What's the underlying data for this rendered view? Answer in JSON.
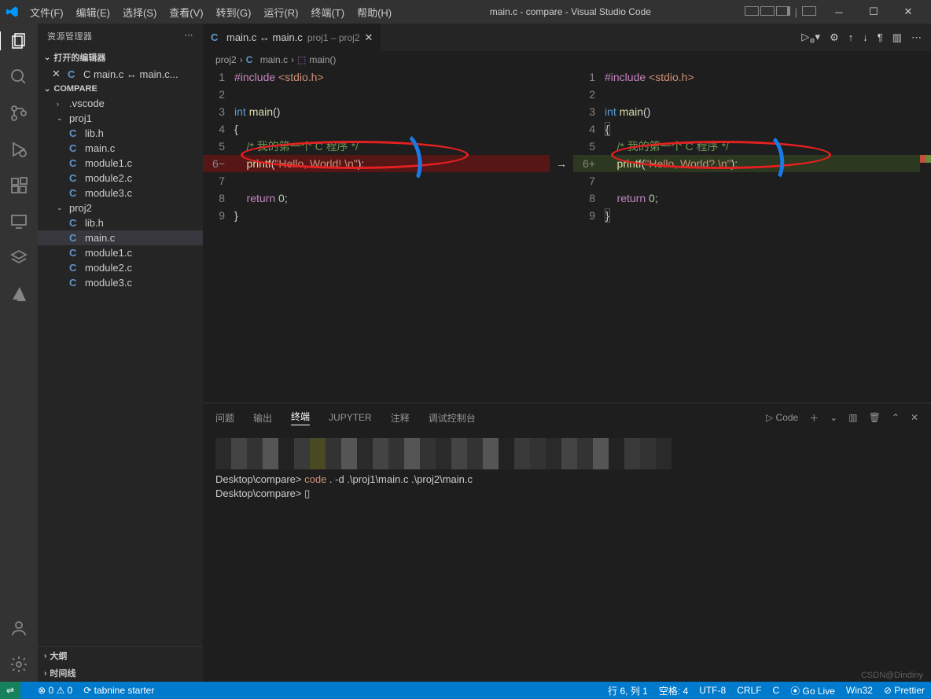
{
  "titlebar": {
    "menu": [
      "文件(F)",
      "编辑(E)",
      "选择(S)",
      "查看(V)",
      "转到(G)",
      "运行(R)",
      "终端(T)",
      "帮助(H)"
    ],
    "title": "main.c - compare - Visual Studio Code"
  },
  "sidebar": {
    "title": "资源管理器",
    "open_editors": "打开的编辑器",
    "open_item": "C  main.c ↔ main.c...",
    "workspace": "COMPARE",
    "tree": {
      "vscode": ".vscode",
      "proj1": "proj1",
      "proj1_files": [
        "lib.h",
        "main.c",
        "module1.c",
        "module2.c",
        "module3.c"
      ],
      "proj2": "proj2",
      "proj2_files": [
        "lib.h",
        "main.c",
        "module1.c",
        "module2.c",
        "module3.c"
      ]
    },
    "outline": "大纲",
    "timeline": "时间线"
  },
  "tab": {
    "icon": "C",
    "name": "main.c ↔ main.c",
    "detail": "proj1 – proj2"
  },
  "breadcrumb": {
    "folder": "proj2",
    "file": "main.c",
    "symbol": "main()"
  },
  "code_left": {
    "lines": [
      "1",
      "2",
      "3",
      "4",
      "5",
      "6−",
      "7",
      "8",
      "9"
    ],
    "l1_a": "#include",
    "l1_b": "<stdio.h>",
    "l3_a": "int",
    "l3_b": "main",
    "l3_c": "()",
    "l4": "{",
    "l5": "    /* 我的第一个 C 程序 */",
    "l6_a": "    printf",
    "l6_b": "(",
    "l6_c": "\"Hello, World! \\n\"",
    "l6_d": ");",
    "l8_a": "    return",
    "l8_b": "0",
    "l8_c": ";",
    "l9": "}"
  },
  "code_right": {
    "lines": [
      "1",
      "2",
      "3",
      "4",
      "5",
      "6+",
      "7",
      "8",
      "9"
    ],
    "l6_c": "\"Hello, World? \\n\""
  },
  "panel": {
    "tabs": [
      "问题",
      "输出",
      "终端",
      "JUPYTER",
      "注释",
      "调试控制台"
    ],
    "code_label": "Code",
    "term1_path": "Desktop\\compare>",
    "term1_cmd": "code",
    "term1_args": "  . -d .\\proj1\\main.c .\\proj2\\main.c",
    "term2_path": "Desktop\\compare>",
    "term2_cursor": "▯"
  },
  "statusbar": {
    "remote": "⇌",
    "errors": "⊗ 0 ⚠ 0",
    "tabnine": "⟳ tabnine starter",
    "pos": "行 6, 列 1",
    "spaces": "空格: 4",
    "encoding": "UTF-8",
    "eol": "CRLF",
    "lang": "C",
    "golive": "⦿ Go Live",
    "win": "Win32",
    "prettier": "⊘ Prettier"
  },
  "watermark": "CSDN@Dindiny"
}
